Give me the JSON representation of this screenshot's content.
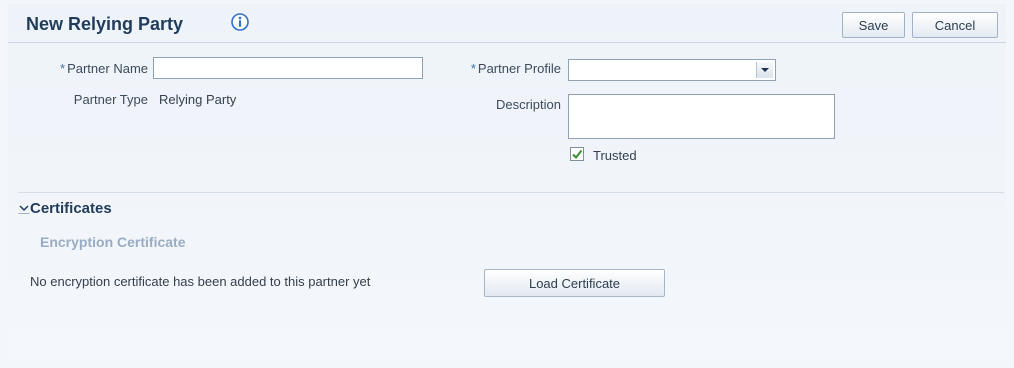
{
  "header": {
    "title": "New Relying Party",
    "save_label": "Save",
    "cancel_label": "Cancel"
  },
  "form": {
    "required_marker": "*",
    "partner_name": {
      "label": "Partner Name",
      "value": ""
    },
    "partner_type": {
      "label": "Partner Type",
      "value": "Relying Party"
    },
    "partner_profile": {
      "label": "Partner Profile",
      "selected": ""
    },
    "description": {
      "label": "Description",
      "value": ""
    },
    "trusted": {
      "label": "Trusted",
      "checked": true
    }
  },
  "certificates": {
    "section_title": "Certificates",
    "encryption_title": "Encryption Certificate",
    "empty_message": "No encryption certificate has been added to this partner yet",
    "load_button_label": "Load Certificate"
  },
  "colors": {
    "title": "#1f3c5b",
    "subhead": "#98acc4",
    "info_icon": "#2f6fd0",
    "check": "#3a8f2e"
  },
  "icons": {
    "info": "info-icon",
    "dropdown": "chevron-down-icon",
    "disclosure": "disclosure-expanded-icon",
    "check": "checkmark-icon"
  }
}
